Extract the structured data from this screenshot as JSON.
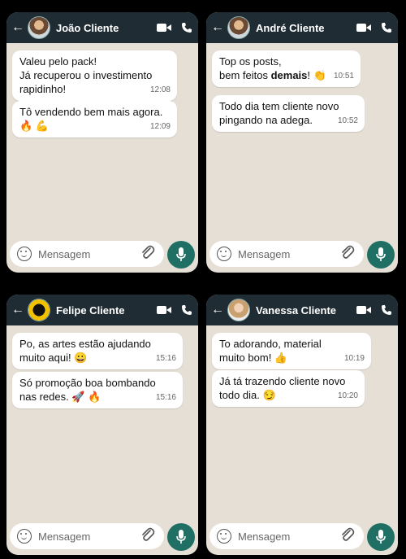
{
  "phones": [
    {
      "contact": "João Cliente",
      "messages": [
        {
          "text": "Valeu pelo pack!\nJá recuperou o investimento\nrapidinho!",
          "time": "12:08"
        },
        {
          "text": "Tô vendendo bem mais agora.\n🔥 💪",
          "time": "12:09"
        }
      ],
      "input_placeholder": "Mensagem"
    },
    {
      "contact": "André Cliente",
      "messages": [
        {
          "text_a": "Top os posts,\nbem feitos ",
          "text_em": "demais",
          "text_b": "! 👏",
          "time": "10:51"
        },
        {
          "text": "Todo dia tem cliente novo\npingando na adega.",
          "time": "10:52"
        }
      ],
      "input_placeholder": "Mensagem"
    },
    {
      "contact": "Felipe Cliente",
      "messages": [
        {
          "text": "Po, as artes estão ajudando\nmuito aqui! 😀",
          "time": "15:16"
        },
        {
          "text": "Só promoção boa bombando\nnas redes. 🚀 🔥",
          "time": "15:16"
        }
      ],
      "input_placeholder": "Mensagem"
    },
    {
      "contact": "Vanessa Cliente",
      "messages": [
        {
          "text": "To adorando, material\nmuito bom! 👍",
          "time": "10:19"
        },
        {
          "text": "Já tá trazendo cliente novo\ntodo dia. 😏",
          "time": "10:20"
        }
      ],
      "input_placeholder": "Mensagem"
    }
  ],
  "icons": {
    "back": "arrow-left-icon",
    "video": "video-camera-icon",
    "call": "phone-icon",
    "emoji": "smiley-icon",
    "attach": "paperclip-icon",
    "mic": "microphone-icon"
  },
  "colors": {
    "header": "#1f2c33",
    "chat_bg": "#e6dfd6",
    "bubble": "#ffffff",
    "mic_button": "#1f6f64"
  }
}
